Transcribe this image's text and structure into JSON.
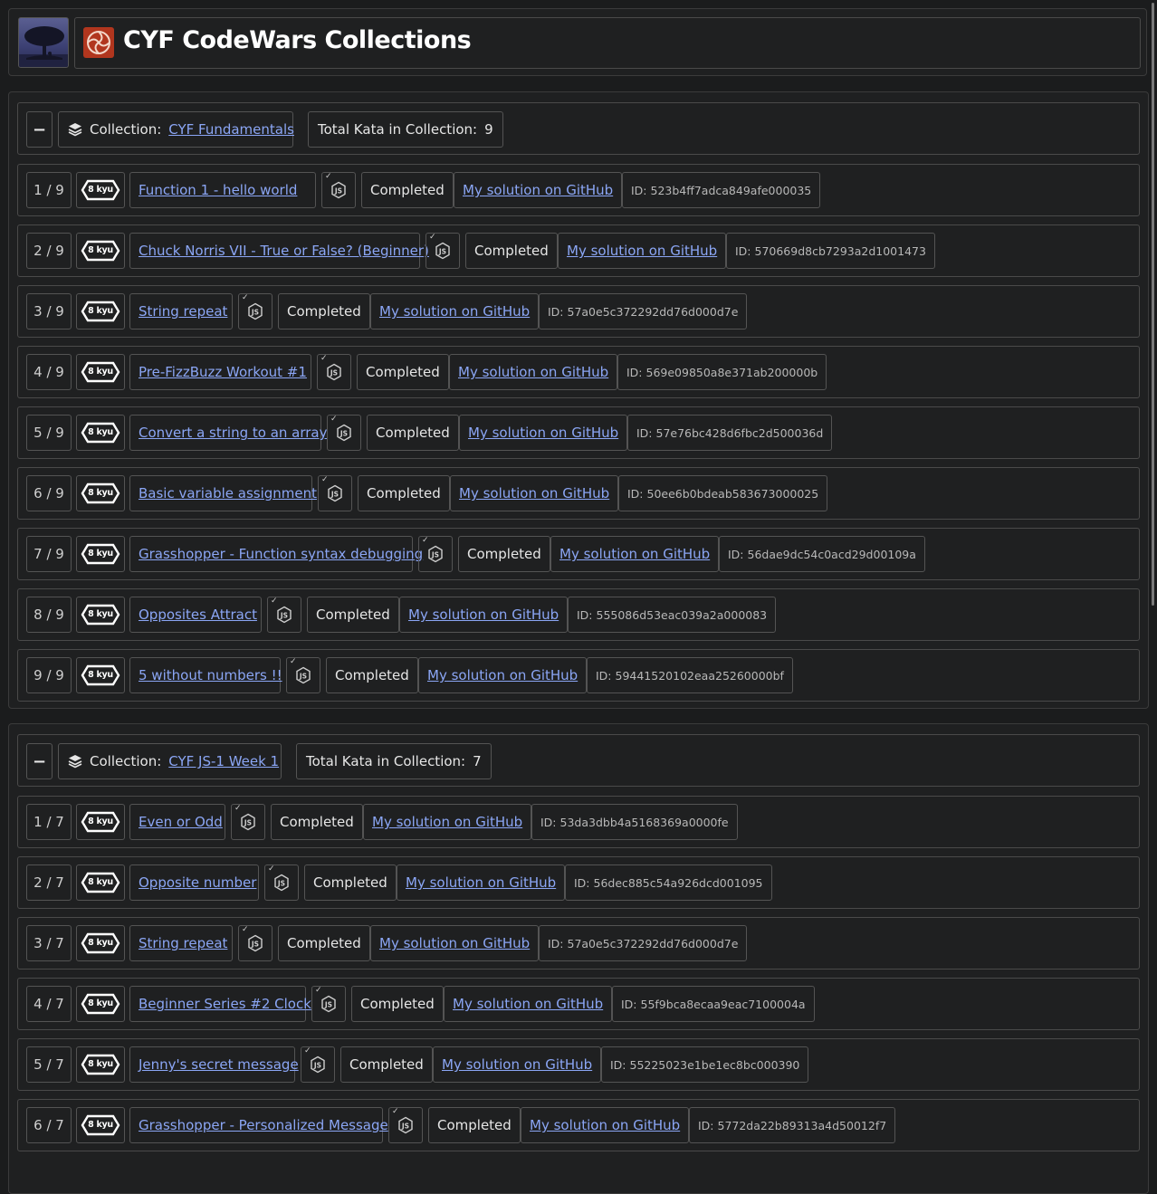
{
  "header": {
    "title": "CYF CodeWars Collections"
  },
  "collections": [
    {
      "label": "Collection:",
      "name": "CYF Fundamentals",
      "total_label": "Total Kata in Collection:",
      "total": "9",
      "items": [
        {
          "index": "1 / 9",
          "rank": "8 kyu",
          "name": "Function 1 - hello world",
          "status": "Completed",
          "solution": "My solution on GitHub",
          "id": "ID: 523b4ff7adca849afe000035"
        },
        {
          "index": "2 / 9",
          "rank": "8 kyu",
          "name": "Chuck Norris VII - True or False? (Beginner)",
          "status": "Completed",
          "solution": "My solution on GitHub",
          "id": "ID: 570669d8cb7293a2d1001473"
        },
        {
          "index": "3 / 9",
          "rank": "8 kyu",
          "name": "String repeat",
          "status": "Completed",
          "solution": "My solution on GitHub",
          "id": "ID: 57a0e5c372292dd76d000d7e"
        },
        {
          "index": "4 / 9",
          "rank": "8 kyu",
          "name": "Pre-FizzBuzz Workout #1",
          "status": "Completed",
          "solution": "My solution on GitHub",
          "id": "ID: 569e09850a8e371ab200000b"
        },
        {
          "index": "5 / 9",
          "rank": "8 kyu",
          "name": "Convert a string to an array",
          "status": "Completed",
          "solution": "My solution on GitHub",
          "id": "ID: 57e76bc428d6fbc2d500036d"
        },
        {
          "index": "6 / 9",
          "rank": "8 kyu",
          "name": "Basic variable assignment",
          "status": "Completed",
          "solution": "My solution on GitHub",
          "id": "ID: 50ee6b0bdeab583673000025"
        },
        {
          "index": "7 / 9",
          "rank": "8 kyu",
          "name": "Grasshopper - Function syntax debugging",
          "status": "Completed",
          "solution": "My solution on GitHub",
          "id": "ID: 56dae9dc54c0acd29d00109a"
        },
        {
          "index": "8 / 9",
          "rank": "8 kyu",
          "name": "Opposites Attract",
          "status": "Completed",
          "solution": "My solution on GitHub",
          "id": "ID: 555086d53eac039a2a000083"
        },
        {
          "index": "9 / 9",
          "rank": "8 kyu",
          "name": "5 without numbers !!",
          "status": "Completed",
          "solution": "My solution on GitHub",
          "id": "ID: 59441520102eaa25260000bf"
        }
      ]
    },
    {
      "label": "Collection:",
      "name": "CYF JS-1 Week 1",
      "total_label": "Total Kata in Collection:",
      "total": "7",
      "items": [
        {
          "index": "1 / 7",
          "rank": "8 kyu",
          "name": "Even or Odd",
          "status": "Completed",
          "solution": "My solution on GitHub",
          "id": "ID: 53da3dbb4a5168369a0000fe"
        },
        {
          "index": "2 / 7",
          "rank": "8 kyu",
          "name": "Opposite number",
          "status": "Completed",
          "solution": "My solution on GitHub",
          "id": "ID: 56dec885c54a926dcd001095"
        },
        {
          "index": "3 / 7",
          "rank": "8 kyu",
          "name": "String repeat",
          "status": "Completed",
          "solution": "My solution on GitHub",
          "id": "ID: 57a0e5c372292dd76d000d7e"
        },
        {
          "index": "4 / 7",
          "rank": "8 kyu",
          "name": "Beginner Series #2 Clock",
          "status": "Completed",
          "solution": "My solution on GitHub",
          "id": "ID: 55f9bca8ecaa9eac7100004a"
        },
        {
          "index": "5 / 7",
          "rank": "8 kyu",
          "name": "Jenny's secret message",
          "status": "Completed",
          "solution": "My solution on GitHub",
          "id": "ID: 55225023e1be1ec8bc000390"
        },
        {
          "index": "6 / 7",
          "rank": "8 kyu",
          "name": "Grasshopper - Personalized Message",
          "status": "Completed",
          "solution": "My solution on GitHub",
          "id": "ID: 5772da22b89313a4d50012f7"
        }
      ]
    }
  ],
  "icons": {
    "avatar": "tree-silhouette-avatar",
    "logo": "swirl-logo-icon",
    "collection": "layers-icon",
    "rank": "kyu-hexagon-icon",
    "language": "nodejs-hex-icon",
    "check": "checkmark-icon"
  }
}
